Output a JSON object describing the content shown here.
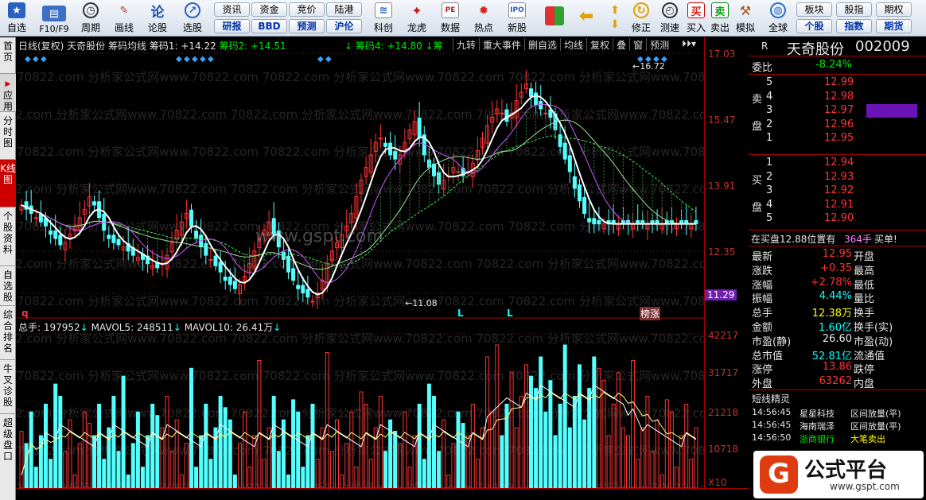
{
  "toolbar": {
    "buttons": [
      {
        "label": "自选",
        "icon": "star-icon"
      },
      {
        "label": "F10/F9",
        "icon": "f10-icon"
      },
      {
        "label": "周期",
        "icon": "clock-icon"
      },
      {
        "label": "画线",
        "icon": "pencil-icon"
      },
      {
        "label": "论股",
        "icon": "discuss-icon"
      },
      {
        "label": "选股",
        "icon": "select-stock-icon"
      }
    ],
    "pills_row1": [
      "资讯",
      "资金",
      "竞价",
      "陆港"
    ],
    "pills_row2": [
      "研报",
      "BBD",
      "预测",
      "沪伦"
    ],
    "buttons2": [
      {
        "label": "科创",
        "icon": "kechuang-icon"
      },
      {
        "label": "龙虎",
        "icon": "dragon-tiger-icon"
      },
      {
        "label": "数据",
        "icon": "pe-data-icon"
      },
      {
        "label": "热点",
        "icon": "hot-icon"
      },
      {
        "label": "新股",
        "icon": "ipo-icon"
      }
    ],
    "buttons3": [
      {
        "label": "修正",
        "icon": "fix-icon"
      },
      {
        "label": "测速",
        "icon": "speed-test-icon"
      },
      {
        "label": "买入",
        "icon": "buy-icon"
      },
      {
        "label": "卖出",
        "icon": "sell-icon"
      },
      {
        "label": "模拟",
        "icon": "simulate-icon"
      },
      {
        "label": "全球",
        "icon": "globe-icon"
      }
    ],
    "pills_right_row1": [
      "板块",
      "股指",
      "期权"
    ],
    "pills_right_row2": [
      "个股",
      "指数",
      "期货"
    ]
  },
  "sidebar": {
    "tabs": [
      "首页",
      "应用",
      "分时图",
      "K线图",
      "个股资料",
      "自选股",
      "综合排名",
      "牛叉诊股",
      "超级盘口"
    ],
    "active": "K线图"
  },
  "chart": {
    "header_prefix": "日线(复权) 天奇股份 筹码均线",
    "chip1": "筹码1: +14.22",
    "chip2": "筹码2: +14.51",
    "chip4": "筹码4: +14.80",
    "chip_more": "筹",
    "menu": [
      "九转",
      "重大事件",
      "删自选",
      "均线",
      "复权",
      "叠",
      "窗",
      "预测"
    ],
    "watermark": "70822.com 分析家公式网www.70822.com",
    "center_watermark": "www.gspt.com",
    "high_label": "16.72",
    "low_label": "11.08",
    "price_ticks": [
      "17.03",
      "15.47",
      "13.91",
      "12.35",
      "11.29"
    ],
    "current_price_tag": "11.29",
    "event_marks": [
      "L",
      "L",
      "榜涨"
    ],
    "q_mark": "q",
    "volume_header": "总手: 197952",
    "mavol5": "MAVOL5: 248511",
    "mavol10": "MAVOL10: 26.41万",
    "volume_ticks": [
      "42217",
      "31717",
      "21218",
      "10718"
    ],
    "unit": "X10",
    "colors": {
      "up": "#ff3232",
      "down": "#54ffff",
      "ma_white": "#ffffff",
      "ma_yellow": "#ffff00",
      "chip_green": "#3fe84a",
      "chip_purple": "#cc55ff"
    }
  },
  "quote": {
    "symbol_r": "R",
    "name": "天奇股份",
    "code": "002009",
    "weibi_label": "委比",
    "weibi": "-8.24%",
    "sell_label": "卖盘",
    "buy_label": "买盘",
    "sells": [
      {
        "lv": "5",
        "price": "12.99"
      },
      {
        "lv": "4",
        "price": "12.98"
      },
      {
        "lv": "3",
        "price": "12.97"
      },
      {
        "lv": "2",
        "price": "12.96"
      },
      {
        "lv": "1",
        "price": "12.95"
      }
    ],
    "buys": [
      {
        "lv": "1",
        "price": "12.94"
      },
      {
        "lv": "2",
        "price": "12.93"
      },
      {
        "lv": "3",
        "price": "12.92"
      },
      {
        "lv": "4",
        "price": "12.91"
      },
      {
        "lv": "5",
        "price": "12.90"
      }
    ],
    "position_note": "在买盘12.88位置有",
    "position_qty": "364手",
    "position_tail": "买单!",
    "stats": [
      {
        "l": "最新",
        "v": "12.95",
        "r": "开盘",
        "vc": "red"
      },
      {
        "l": "涨跌",
        "v": "+0.35",
        "r": "最高",
        "vc": "red"
      },
      {
        "l": "涨幅",
        "v": "+2.78%",
        "r": "最低",
        "vc": "red"
      },
      {
        "l": "振幅",
        "v": "4.44%",
        "r": "量比",
        "vc": "cyan"
      },
      {
        "l": "总手",
        "v": "12.38万",
        "r": "换手",
        "vc": "yellow"
      },
      {
        "l": "金额",
        "v": "1.60亿",
        "r": "换手(实)",
        "vc": "cyan"
      },
      {
        "l": "市盈(静)",
        "v": "26.60",
        "r": "市盈(动)",
        "vc": "white"
      },
      {
        "l": "总市值",
        "v": "52.81亿",
        "r": "流通值",
        "vc": "cyan"
      },
      {
        "l": "涨停",
        "v": "13.86",
        "r": "跌停",
        "vc": "red"
      },
      {
        "l": "外盘",
        "v": "63262",
        "r": "内盘",
        "vc": "red"
      }
    ],
    "elf_title": "短线精灵",
    "elf": [
      {
        "t": "14:56:45",
        "n": "星星科技",
        "e": "区间放量(平)"
      },
      {
        "t": "14:56:45",
        "n": "海南瑞泽",
        "e": "区间放量(平)"
      },
      {
        "t": "14:56:50",
        "n": "浙商银行",
        "e": "大笔卖出"
      }
    ],
    "logo_text": "公式平台",
    "logo_url": "www.gspt.com"
  }
}
